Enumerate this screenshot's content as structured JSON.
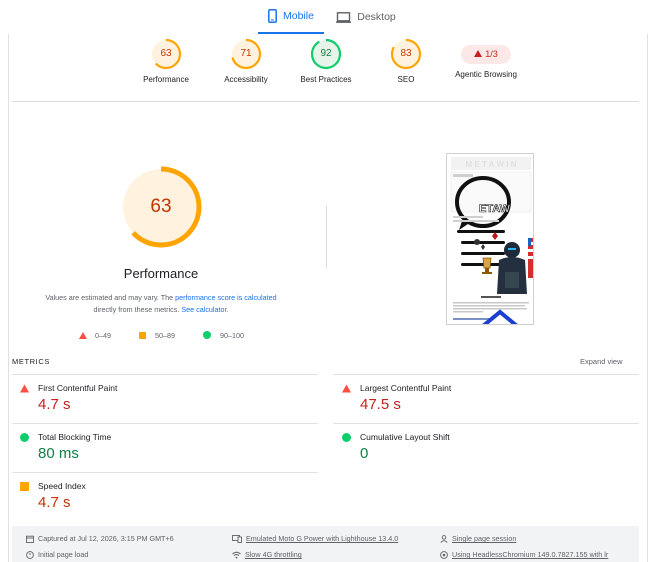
{
  "tabs": [
    {
      "label": "Mobile",
      "active": true
    },
    {
      "label": "Desktop",
      "active": false
    }
  ],
  "summary": [
    {
      "score": "63",
      "label": "Performance",
      "color": "#ffa400"
    },
    {
      "score": "71",
      "label": "Accessibility",
      "color": "#ffa400"
    },
    {
      "score": "92",
      "label": "Best Practices",
      "color": "#0cce6b"
    },
    {
      "score": "83",
      "label": "SEO",
      "color": "#ffa400"
    }
  ],
  "agentic": {
    "badge": "1/3",
    "label": "Agentic Browsing"
  },
  "performance": {
    "score": "63",
    "title": "Performance",
    "disclaimer_1": "Values are estimated and may vary. The ",
    "disclaimer_link1": "performance score is calculated",
    "disclaimer_2": "directly from these metrics. ",
    "disclaimer_link2": "See calculator."
  },
  "legend": [
    {
      "range": "0–49",
      "shape": "triangle",
      "color": "#ff4e42"
    },
    {
      "range": "50–89",
      "shape": "square",
      "color": "#ffa400"
    },
    {
      "range": "90–100",
      "shape": "circle",
      "color": "#0cce6b"
    }
  ],
  "metrics_header": "METRICS",
  "expand_label": "Expand view",
  "metrics": [
    {
      "name": "First Contentful Paint",
      "value": "4.7 s",
      "status": "fail",
      "icon": "triangle-icon"
    },
    {
      "name": "Largest Contentful Paint",
      "value": "47.5 s",
      "status": "fail",
      "icon": "triangle-icon"
    },
    {
      "name": "Total Blocking Time",
      "value": "80 ms",
      "status": "pass",
      "icon": "circle-icon"
    },
    {
      "name": "Cumulative Layout Shift",
      "value": "0",
      "status": "pass",
      "icon": "circle-icon"
    },
    {
      "name": "Speed Index",
      "value": "4.7 s",
      "status": "average",
      "icon": "square-icon"
    }
  ],
  "colors": {
    "fail": "#c5221f",
    "pass": "#0d8043",
    "average": "#c33300",
    "accent": "#1a73e8"
  },
  "footer": {
    "captured": "Captured at Jul 12, 2026, 3:15 PM GMT+6",
    "initial_load": "Initial page load",
    "emulated": "Emulated Moto G Power with Lighthouse 13.4.0",
    "throttling": "Slow 4G throttling",
    "session": "Single page session",
    "using": "Using HeadlessChromium 149.0.7827.155 with lr"
  },
  "thumbnail": {
    "logo_text": "M E T A W I N"
  }
}
